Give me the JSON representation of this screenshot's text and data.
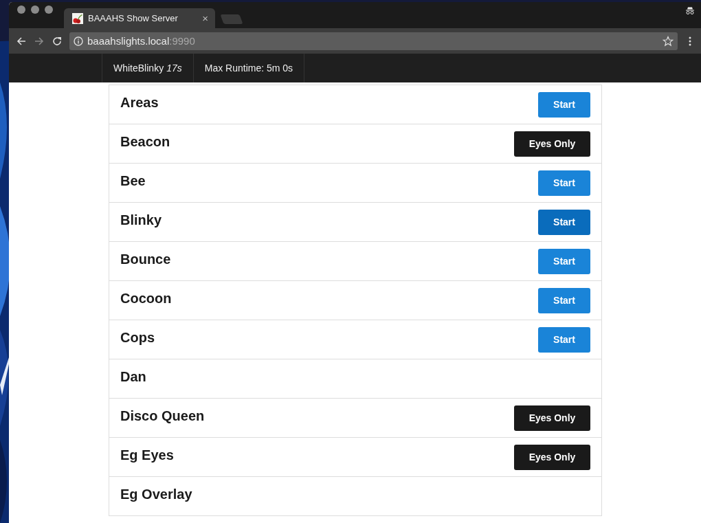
{
  "browser": {
    "tab": {
      "title": "BAAAHS Show Server",
      "close": "×"
    },
    "address": {
      "host": "baaahslights.local",
      "port": ":9990"
    }
  },
  "header": {
    "show": {
      "name": "WhiteBlinky",
      "elapsed": "17s"
    },
    "max_runtime": "Max Runtime: 5m 0s"
  },
  "shows": [
    {
      "name": "Areas",
      "button": {
        "kind": "start",
        "label": "Start",
        "hovered": false
      }
    },
    {
      "name": "Beacon",
      "button": {
        "kind": "eyes-only",
        "label": "Eyes Only",
        "hovered": false
      }
    },
    {
      "name": "Bee",
      "button": {
        "kind": "start",
        "label": "Start",
        "hovered": false
      }
    },
    {
      "name": "Blinky",
      "button": {
        "kind": "start",
        "label": "Start",
        "hovered": true
      }
    },
    {
      "name": "Bounce",
      "button": {
        "kind": "start",
        "label": "Start",
        "hovered": false
      }
    },
    {
      "name": "Cocoon",
      "button": {
        "kind": "start",
        "label": "Start",
        "hovered": false
      }
    },
    {
      "name": "Cops",
      "button": {
        "kind": "start",
        "label": "Start",
        "hovered": false
      }
    },
    {
      "name": "Dan"
    },
    {
      "name": "Disco Queen",
      "button": {
        "kind": "eyes-only",
        "label": "Eyes Only",
        "hovered": false
      }
    },
    {
      "name": "Eg Eyes",
      "button": {
        "kind": "eyes-only",
        "label": "Eyes Only",
        "hovered": false
      }
    },
    {
      "name": "Eg Overlay"
    }
  ]
}
